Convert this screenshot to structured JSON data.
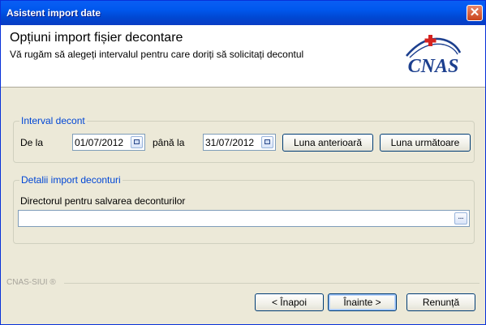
{
  "window": {
    "title": "Asistent import date",
    "close_glyph": "✕"
  },
  "header": {
    "title": "Opțiuni import fișier decontare",
    "subtitle": "Vă rugăm să alegeți intervalul pentru care doriți să solicitați decontul",
    "logo_text": "CNAS"
  },
  "interval": {
    "legend": "Interval decont",
    "from_label": "De la",
    "from_value": "01/07/2012",
    "to_label": "până la",
    "to_value": "31/07/2012",
    "prev_month_button": "Luna anterioară",
    "next_month_button": "Luna următoare"
  },
  "details": {
    "legend": "Detalii import deconturi",
    "folder_label": "Directorul pentru salvarea deconturilor",
    "folder_value": "",
    "browse_glyph": "..."
  },
  "footer": {
    "brand": "CNAS-SIUI ®",
    "back_button": "< Înapoi",
    "next_button": "Înainte >",
    "cancel_button": "Renunță"
  },
  "colors": {
    "titlebar": "#0058ee",
    "dialog_bg": "#ece9d8",
    "legend_text": "#0046d5",
    "logo_blue": "#1c3f8e",
    "logo_red": "#d5231f"
  }
}
